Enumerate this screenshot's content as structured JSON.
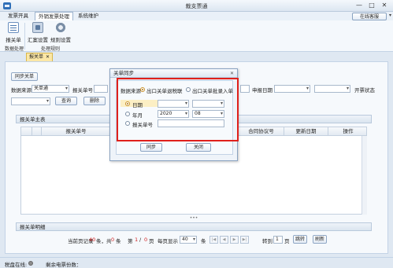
{
  "window": {
    "title": "裁支票通",
    "minimize": "—",
    "maximize": "□",
    "close": "✕"
  },
  "menu": {
    "items": [
      {
        "label": "发票开具",
        "active": false
      },
      {
        "label": "外销发票处理",
        "active": true
      },
      {
        "label": "系统维护",
        "active": false
      }
    ],
    "online_service": "在线客服"
  },
  "ribbon": {
    "buttons": [
      {
        "label": "报关单",
        "icon": "document-icon"
      },
      {
        "label": "汇案设置",
        "icon": "summary-icon"
      },
      {
        "label": "规则设置",
        "icon": "gear-icon"
      }
    ],
    "groups": [
      "数据处理",
      "处理规则"
    ]
  },
  "doc_tab": {
    "label": "报关单",
    "close": "✕"
  },
  "toolbar": {
    "sync_button": "同步关单",
    "data_source_label": "数据来源",
    "data_source_value": "关单通",
    "customs_no_label": "报关单号",
    "declare_date_label": "申报日期",
    "invoice_status_label": "开票状态",
    "query_button": "查询",
    "delete_button": "删除"
  },
  "main_table": {
    "title": "报关单主表",
    "columns": [
      "报关单号",
      "合同协议号",
      "更新日期",
      "操作"
    ]
  },
  "detail_panel": {
    "title": "报关单明细"
  },
  "pager": {
    "current_prefix": "当前页记录",
    "current_count": "40",
    "current_mid": "条，共",
    "total_count": "0",
    "current_suffix": "条",
    "page_prefix": "第",
    "page_current": "1",
    "page_sep": "/",
    "page_total": "0",
    "page_suffix": "页",
    "per_page_label": "每页显示",
    "per_page_value": "40",
    "per_page_unit": "条",
    "goto_label": "转到",
    "goto_value": "1",
    "goto_unit": "页",
    "jump_button": "跳转",
    "refresh_button": "刷新"
  },
  "status": {
    "disk_label": "税盘在线:",
    "remaining_label": "剩余电票份数："
  },
  "dialog": {
    "title": "关单同步",
    "close": "✕",
    "source_label": "数据来源",
    "option_refund": "出口关单退税联",
    "option_manual": "出口关单批录入单",
    "opt_date": "日期",
    "opt_month": "年月",
    "year_value": "2020",
    "month_value": "08",
    "opt_customs": "报关单号",
    "sync_button": "同步",
    "close_button": "关闭"
  }
}
